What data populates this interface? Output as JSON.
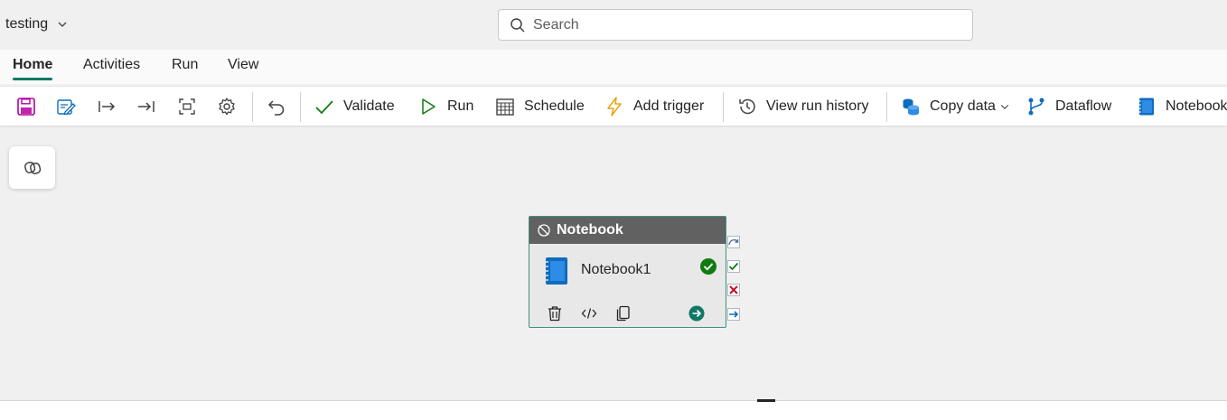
{
  "workspace": {
    "name": "testing",
    "chevron_icon": "chevron-down-icon"
  },
  "search": {
    "placeholder": "Search",
    "value": ""
  },
  "tabs": [
    {
      "label": "Home",
      "active": true
    },
    {
      "label": "Activities",
      "active": false
    },
    {
      "label": "Run",
      "active": false
    },
    {
      "label": "View",
      "active": false
    }
  ],
  "toolbar": {
    "icons": [
      "save-icon",
      "edit-icon",
      "move-right-icon",
      "align-end-icon",
      "fit-view-icon",
      "gear-icon",
      "undo-icon"
    ],
    "validate_label": "Validate",
    "run_label": "Run",
    "schedule_label": "Schedule",
    "add_trigger_label": "Add trigger",
    "view_run_history_label": "View run history",
    "copy_data_label": "Copy data",
    "dataflow_label": "Dataflow",
    "notebook_label": "Notebook"
  },
  "activity": {
    "type_label": "Notebook",
    "name": "Notebook1",
    "status": "valid"
  },
  "colors": {
    "accent": "#117865",
    "activity_border": "#3f8f82",
    "header": "#616161",
    "success": "#107c10",
    "failure": "#c50f1f",
    "completion": "#0f6cbd"
  }
}
